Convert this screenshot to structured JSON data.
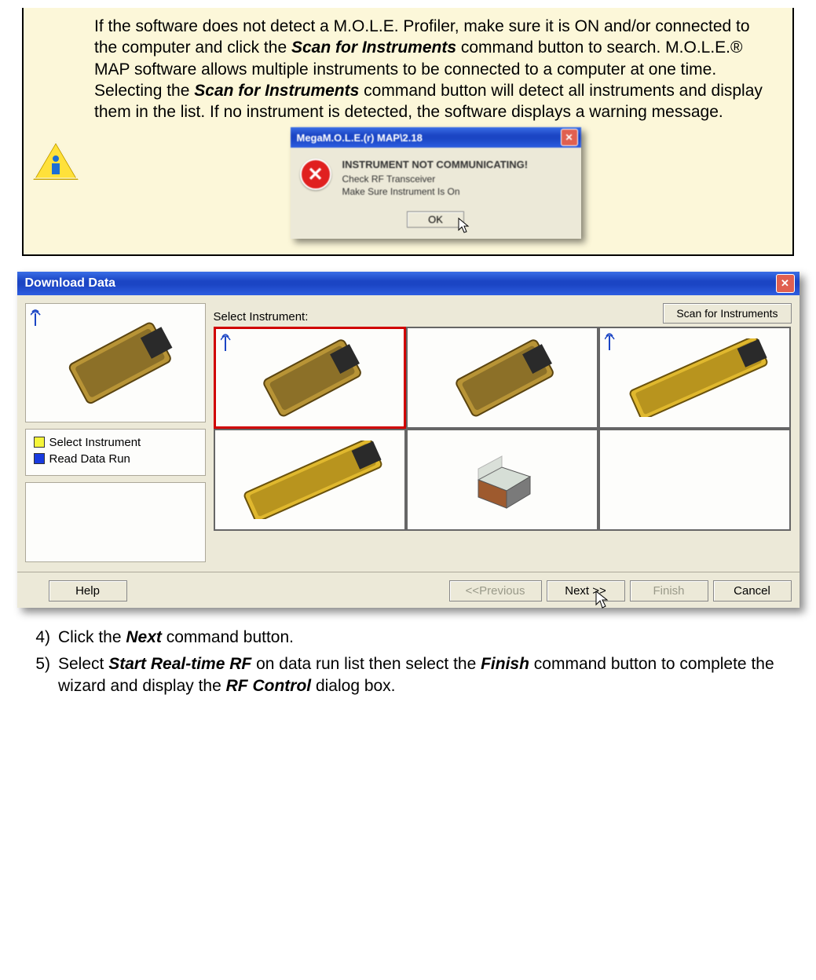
{
  "note": {
    "text_parts": {
      "p1": "If the software does not detect a M.O.L.E. Profiler, make sure it is ON and/or connected to the computer and click the ",
      "b1": "Scan for Instruments",
      "p2": " command button to search. M.O.L.E.® MAP software allows multiple instruments to be connected to a computer at one time. Selecting the ",
      "b2": "Scan for Instruments",
      "p3": " command button will detect all instruments and display them in the list. If no instrument is detected, the software displays a warning message."
    },
    "msgbox": {
      "title": "MegaM.O.L.E.(r) MAP\\2.18",
      "header": "INSTRUMENT NOT COMMUNICATING!",
      "line1": "Check RF Transceiver",
      "line2": "Make Sure Instrument Is On",
      "ok": "OK"
    }
  },
  "dlg": {
    "title": "Download Data",
    "select_label": "Select Instrument:",
    "scan_btn": "Scan for Instruments",
    "steps": [
      {
        "label": "Select Instrument",
        "color": "y"
      },
      {
        "label": "Read Data Run",
        "color": "b"
      }
    ],
    "instruments": [
      {
        "name": "MOLE Profiler RF Gold",
        "rf": true,
        "selected": true,
        "color": "gold"
      },
      {
        "name": "MOLE Profiler Gold",
        "rf": false,
        "selected": false,
        "color": "gold"
      },
      {
        "name": "MOLE Profiler Long RF",
        "rf": true,
        "selected": false,
        "color": "goldlong"
      },
      {
        "name": "MOLE Profiler Long",
        "rf": false,
        "selected": false,
        "color": "goldlong"
      },
      {
        "name": "MOLE Cube",
        "rf": false,
        "selected": false,
        "color": "cube"
      },
      {
        "name": "",
        "rf": false,
        "selected": false,
        "color": "empty"
      }
    ],
    "buttons": {
      "help": "Help",
      "prev": "<<Previous",
      "next": "Next >>",
      "finish": "Finish",
      "cancel": "Cancel"
    }
  },
  "list": {
    "n4": "4)",
    "t4a": "Click the ",
    "t4b": "Next",
    "t4c": " command button.",
    "n5": "5)",
    "t5a": "Select ",
    "t5b": "Start Real-time RF",
    "t5c": " on data run list then select the ",
    "t5d": "Finish",
    "t5e": " command button to complete the wizard and display the ",
    "t5f": "RF Control",
    "t5g": " dialog box."
  }
}
